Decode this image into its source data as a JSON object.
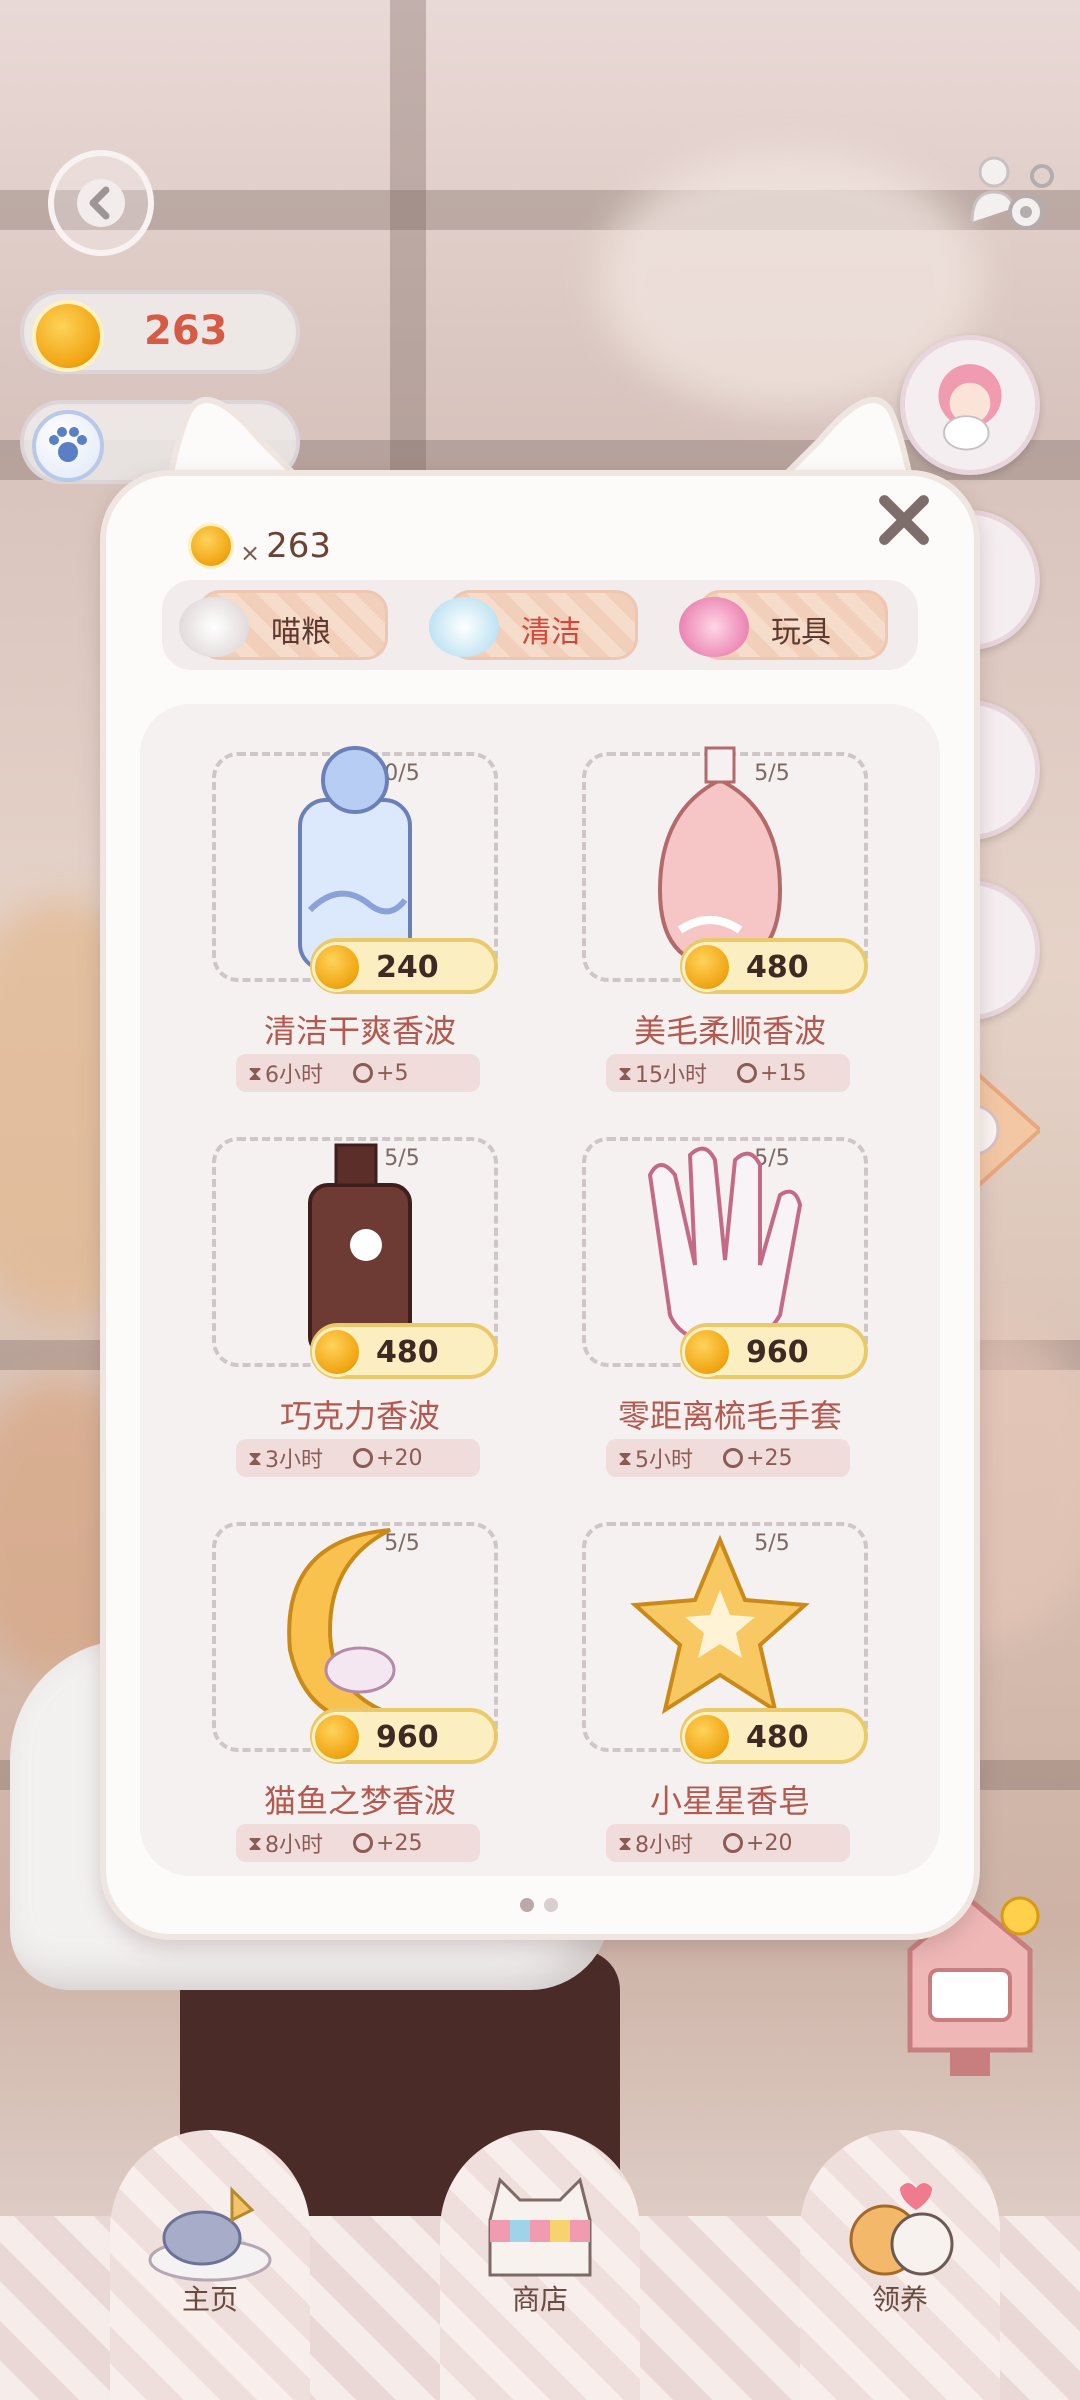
{
  "status": {
    "coin_balance": "263"
  },
  "modal": {
    "balance_multiplier": "×",
    "balance_amount": "263",
    "tabs": [
      {
        "label": "喵粮",
        "icon": "fish-bowl-icon",
        "active": false
      },
      {
        "label": "清洁",
        "icon": "bathtub-icon",
        "active": true
      },
      {
        "label": "玩具",
        "icon": "yarn-ball-icon",
        "active": false
      }
    ],
    "items": [
      {
        "name": "清洁干爽香波",
        "count": "0/5",
        "price": "240",
        "time": "6小时",
        "bonus": "+5",
        "icon": "blue-shampoo-bottle-icon"
      },
      {
        "name": "美毛柔顺香波",
        "count": "5/5",
        "price": "480",
        "time": "15小时",
        "bonus": "+15",
        "icon": "pink-shampoo-bottle-icon"
      },
      {
        "name": "巧克力香波",
        "count": "5/5",
        "price": "480",
        "time": "3小时",
        "bonus": "+20",
        "icon": "chocolate-shampoo-bottle-icon"
      },
      {
        "name": "零距离梳毛手套",
        "count": "5/5",
        "price": "960",
        "time": "5小时",
        "bonus": "+25",
        "icon": "grooming-glove-icon"
      },
      {
        "name": "猫鱼之梦香波",
        "count": "5/5",
        "price": "960",
        "time": "8小时",
        "bonus": "+25",
        "icon": "moon-shampoo-icon"
      },
      {
        "name": "小星星香皂",
        "count": "5/5",
        "price": "480",
        "time": "8小时",
        "bonus": "+20",
        "icon": "star-soap-icon"
      }
    ]
  },
  "bottom_nav": [
    {
      "label": "主页",
      "icon": "cat-home-icon"
    },
    {
      "label": "商店",
      "icon": "cat-shop-icon"
    },
    {
      "label": "领养",
      "icon": "adopt-cats-icon"
    }
  ],
  "colors": {
    "accent": "#d04a3c",
    "coin": "#f0a412",
    "item_name": "#b5584e"
  }
}
